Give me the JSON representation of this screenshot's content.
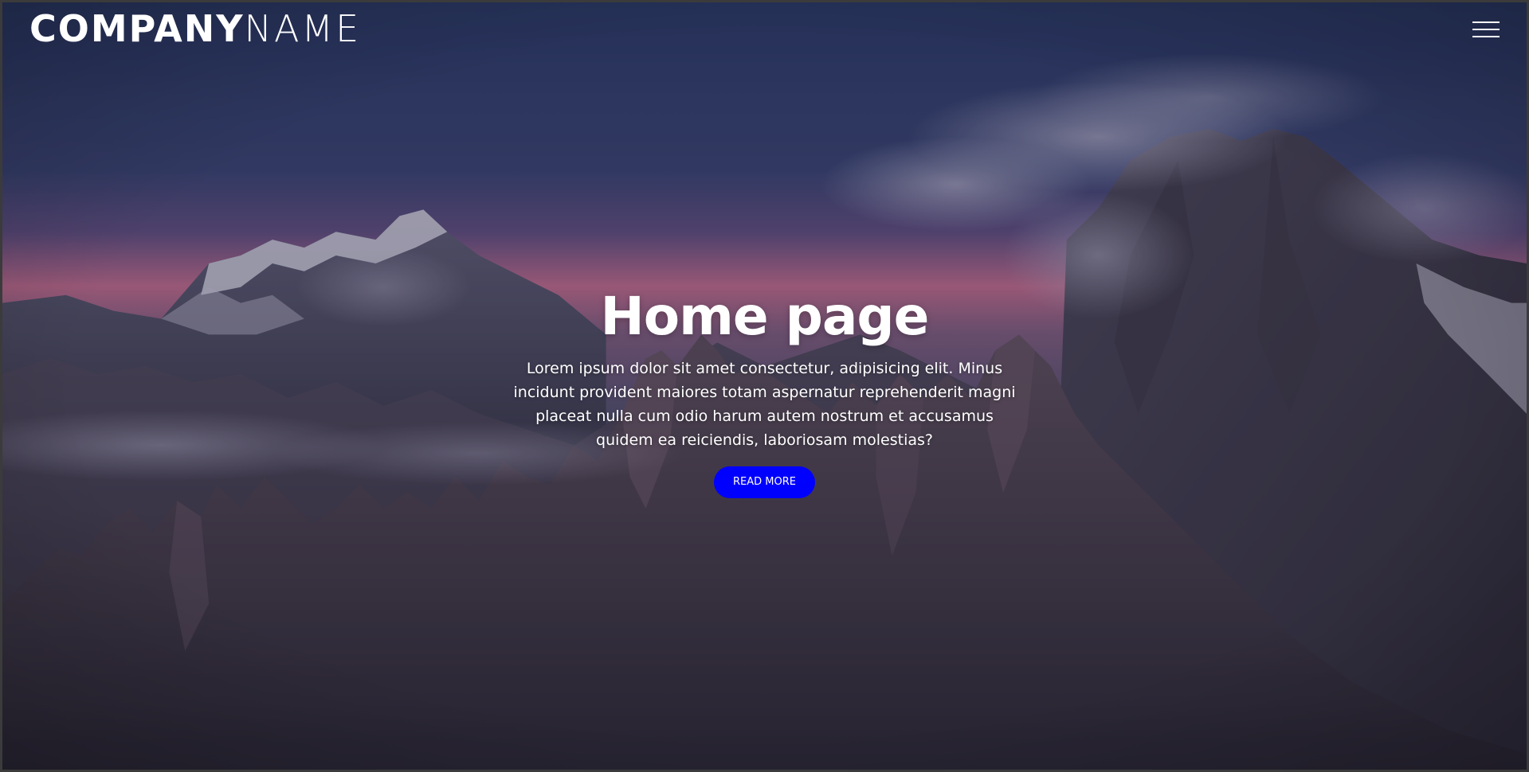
{
  "navbar": {
    "brand_bold": "COMPANY",
    "brand_light": "NAME",
    "menu_icon": "hamburger-menu-icon"
  },
  "hero": {
    "title": "Home page",
    "description": "Lorem ipsum dolor sit amet consectetur, adipisicing elit. Minus incidunt provident maiores totam aspernatur reprehenderit magni placeat nulla cum odio harum autem nostrum et accusamus quidem ea reiciendis, laboriosam molestias?",
    "button_label": "READ MORE",
    "background": "mountain-landscape-image"
  },
  "colors": {
    "button": "#0000ff",
    "text": "#ffffff",
    "sky_top": "#2c3a63",
    "sunset": "#c46a86"
  }
}
